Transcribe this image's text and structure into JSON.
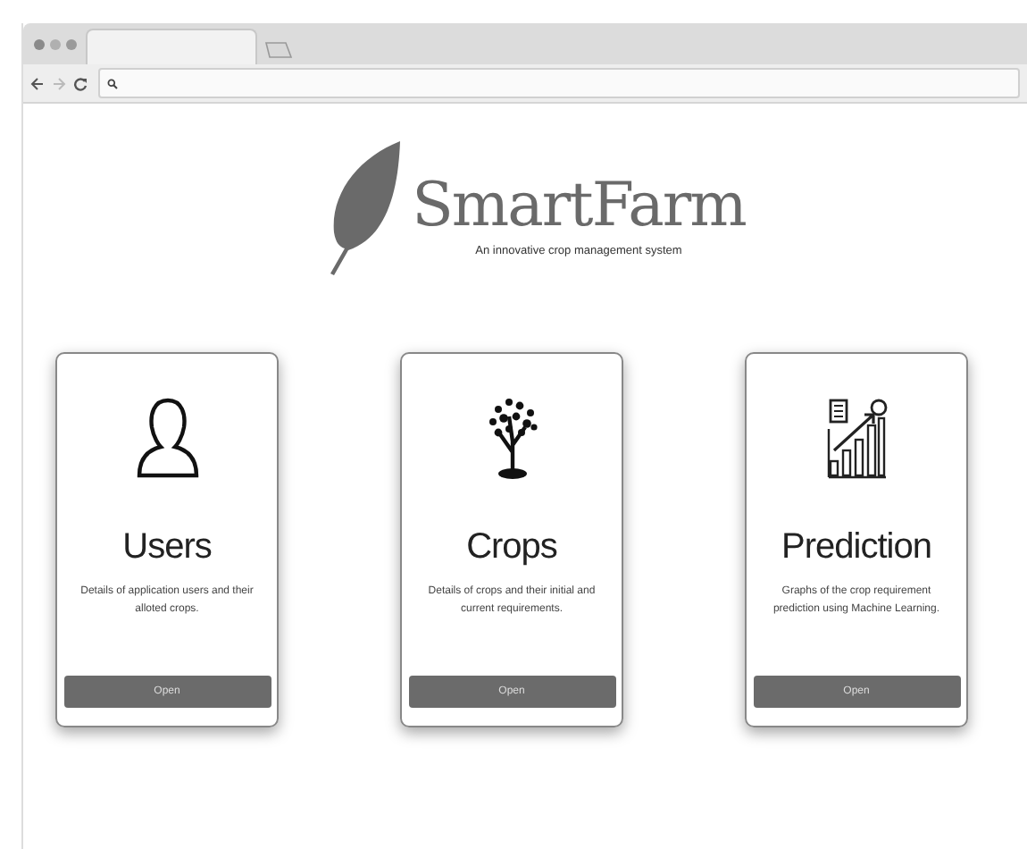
{
  "brand": {
    "name": "SmartFarm",
    "tagline": "An innovative crop management system"
  },
  "cards": [
    {
      "kind": "user",
      "title": "Users",
      "description": "Details of application users and their alloted crops.",
      "button": "Open"
    },
    {
      "kind": "tree",
      "title": "Crops",
      "description": "Details of crops and their initial and current requirements.",
      "button": "Open"
    },
    {
      "kind": "chart",
      "title": "Prediction",
      "description": "Graphs of the crop requirement prediction using Machine Learning.",
      "button": "Open"
    }
  ]
}
